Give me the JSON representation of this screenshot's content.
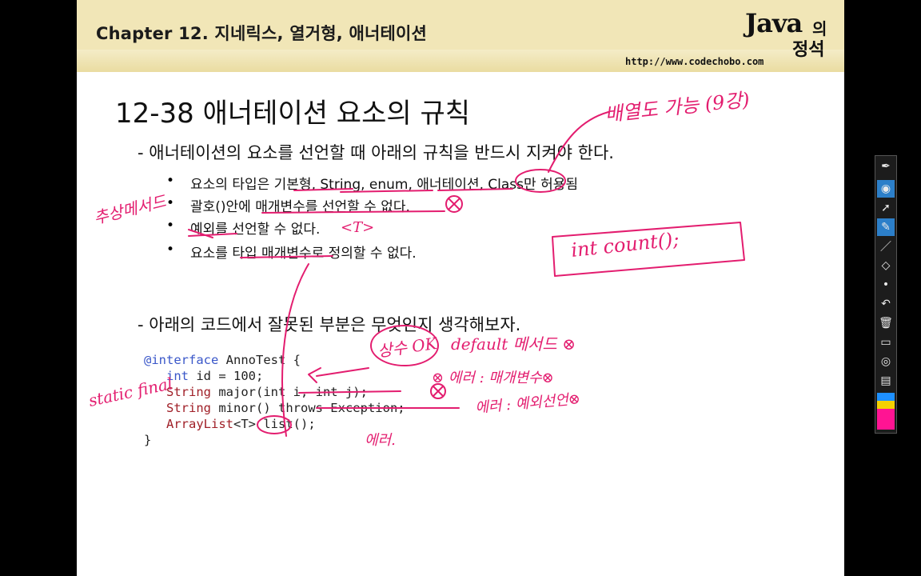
{
  "header": {
    "chapter_title": "Chapter 12. 지네릭스, 열거형, 애너테이션",
    "logo_java": "Java",
    "logo_eui": "의",
    "logo_jeongseok": "정석",
    "url": "http://www.codechobo.com"
  },
  "slide": {
    "title": "12-38 애너테이션 요소의 규칙",
    "rules_intro": "- 애너테이션의 요소를 선언할 때 아래의 규칙을 반드시 지켜야 한다.",
    "bullets": [
      "요소의 타입은 기본형, String, enum, 애너테이션, Class만 허용됨",
      "괄호()안에 매개변수를 선언할 수 없다.",
      "예외를 선언할 수 없다.",
      "요소를 타입 매개변수로 정의할 수 없다."
    ],
    "bullet_symbol": "•",
    "code_intro": "- 아래의 코드에서 잘못된 부분은 무엇인지 생각해보자.",
    "code": {
      "line1_kw": "@interface",
      "line1_rest": " AnnoTest {",
      "line2_type": "int",
      "line2_rest": " id = 100;",
      "line3_type": "String",
      "line3_rest": " major(int i, int j);",
      "line4_type": "String",
      "line4_rest": " minor() throws Exception;",
      "line5_type": "ArrayList",
      "line5_rest": "<T> list();",
      "line6": "}"
    }
  },
  "annotations": {
    "pen_color": "#e31d6f",
    "top_right": "배열도 가능 (9강)",
    "left_margin": "추상메서드",
    "type_param": "<T>",
    "box_code": "int count();",
    "constant_ok": "상수 OK",
    "default_method": "default 메서드 ⊗",
    "static_final": "static final",
    "error_param": "⊗ 에러 : 매개변수⊗",
    "error_exception": "에러 : 예외선언⊗",
    "error": "에러."
  },
  "toolbar": {
    "icons": [
      "pen-nib-icon",
      "eye-icon",
      "pointer-icon",
      "highlighter-icon",
      "pen-icon",
      "eraser-icon",
      "dot-icon",
      "undo-icon",
      "trash-icon",
      "screen-icon",
      "camera-icon",
      "clipboard-icon"
    ],
    "swatch_colors": [
      "#1e90ff",
      "#f5d000",
      "#ff1493",
      "#000000"
    ]
  }
}
